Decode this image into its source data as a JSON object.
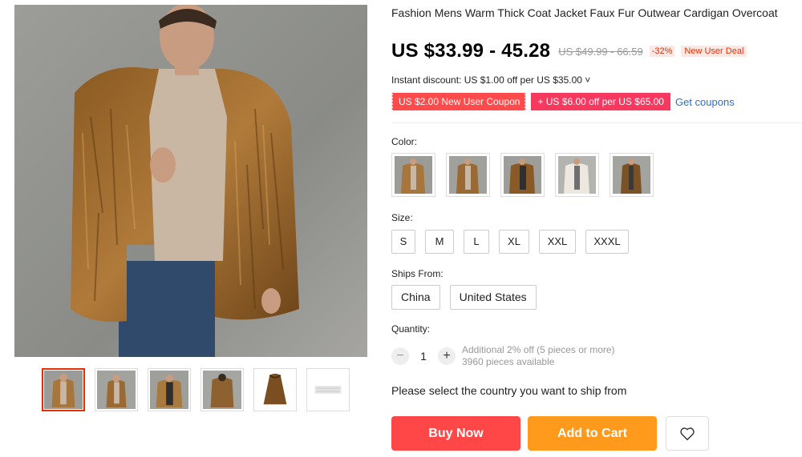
{
  "product": {
    "title": "Fashion Mens Warm Thick Coat Jacket Faux Fur Outwear Cardigan Overcoat",
    "price": "US $33.99 - 45.28",
    "original_price": "US $49.99 - 66.59",
    "discount": "-32%",
    "new_user_badge": "New User Deal",
    "instant_discount": "Instant discount: US $1.00 off per US $35.00 ˅",
    "coupons": [
      "US $2.00 New User Coupon",
      "+ US $6.00 off per US $65.00"
    ],
    "get_coupons": "Get coupons"
  },
  "gallery": {
    "main_image_icon": "man-in-faux-fur-coat-photo",
    "selected_thumb": 0,
    "thumbs": [
      "thumb-front",
      "thumb-side",
      "thumb-open",
      "thumb-back",
      "thumb-flat",
      "thumb-label"
    ]
  },
  "options": {
    "color_label": "Color:",
    "colors": [
      "brown-front",
      "brown-side",
      "brown-dark",
      "white",
      "brown-long"
    ],
    "size_label": "Size:",
    "sizes": [
      "S",
      "M",
      "L",
      "XL",
      "XXL",
      "XXXL"
    ],
    "ships_label": "Ships From:",
    "ships": [
      "China",
      "United States"
    ]
  },
  "quantity": {
    "label": "Quantity:",
    "value": "1",
    "minus": "−",
    "plus": "+",
    "note1": "Additional 2% off (5 pieces or more)",
    "note2": "3960 pieces available"
  },
  "shipping_message": "Please select the country you want to ship from",
  "actions": {
    "buy_now": "Buy Now",
    "add_to_cart": "Add to Cart",
    "wishlist_icon": "heart-icon"
  },
  "colors": {
    "accent_red": "#ff4747",
    "cart_orange": "#ff9a1c",
    "link_blue": "#2b6fd1",
    "discount_red": "#e62e04"
  }
}
